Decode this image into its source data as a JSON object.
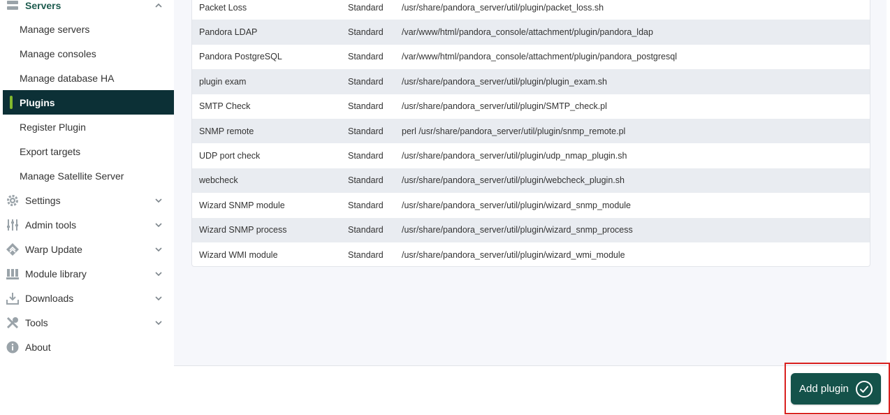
{
  "sidebar": {
    "servers_label": "Servers",
    "sub_items": [
      {
        "label": "Manage servers"
      },
      {
        "label": "Manage consoles"
      },
      {
        "label": "Manage database HA"
      },
      {
        "label": "Plugins"
      },
      {
        "label": "Register Plugin"
      },
      {
        "label": "Export targets"
      },
      {
        "label": "Manage Satellite Server"
      }
    ],
    "groups": [
      {
        "label": "Settings",
        "icon": "gear-icon"
      },
      {
        "label": "Admin tools",
        "icon": "sliders-icon"
      },
      {
        "label": "Warp Update",
        "icon": "warp-icon"
      },
      {
        "label": "Module library",
        "icon": "library-icon"
      },
      {
        "label": "Downloads",
        "icon": "download-icon"
      },
      {
        "label": "Tools",
        "icon": "tools-icon"
      },
      {
        "label": "About",
        "icon": "info-icon"
      }
    ]
  },
  "plugins_table": {
    "rows": [
      {
        "name": "Packet Loss",
        "type": "Standard",
        "command": "/usr/share/pandora_server/util/plugin/packet_loss.sh"
      },
      {
        "name": "Pandora LDAP",
        "type": "Standard",
        "command": "/var/www/html/pandora_console/attachment/plugin/pandora_ldap"
      },
      {
        "name": "Pandora PostgreSQL",
        "type": "Standard",
        "command": "/var/www/html/pandora_console/attachment/plugin/pandora_postgresql"
      },
      {
        "name": "plugin exam",
        "type": "Standard",
        "command": "/usr/share/pandora_server/util/plugin/plugin_exam.sh"
      },
      {
        "name": "SMTP Check",
        "type": "Standard",
        "command": "/usr/share/pandora_server/util/plugin/SMTP_check.pl"
      },
      {
        "name": "SNMP remote",
        "type": "Standard",
        "command": "perl /usr/share/pandora_server/util/plugin/snmp_remote.pl"
      },
      {
        "name": "UDP port check",
        "type": "Standard",
        "command": "/usr/share/pandora_server/util/plugin/udp_nmap_plugin.sh"
      },
      {
        "name": "webcheck",
        "type": "Standard",
        "command": "/usr/share/pandora_server/util/plugin/webcheck_plugin.sh"
      },
      {
        "name": "Wizard SNMP module",
        "type": "Standard",
        "command": "/usr/share/pandora_server/util/plugin/wizard_snmp_module"
      },
      {
        "name": "Wizard SNMP process",
        "type": "Standard",
        "command": "/usr/share/pandora_server/util/plugin/wizard_snmp_process"
      },
      {
        "name": "Wizard WMI module",
        "type": "Standard",
        "command": "/usr/share/pandora_server/util/plugin/wizard_wmi_module"
      }
    ]
  },
  "actions": {
    "add_plugin_label": "Add plugin",
    "add_plugin_icon": "check-circle-icon"
  },
  "colors": {
    "sidebar_selected_bg": "#0c3036",
    "selected_indicator": "#82b92e",
    "primary_button": "#14524a",
    "highlight_frame": "#d9211f"
  }
}
